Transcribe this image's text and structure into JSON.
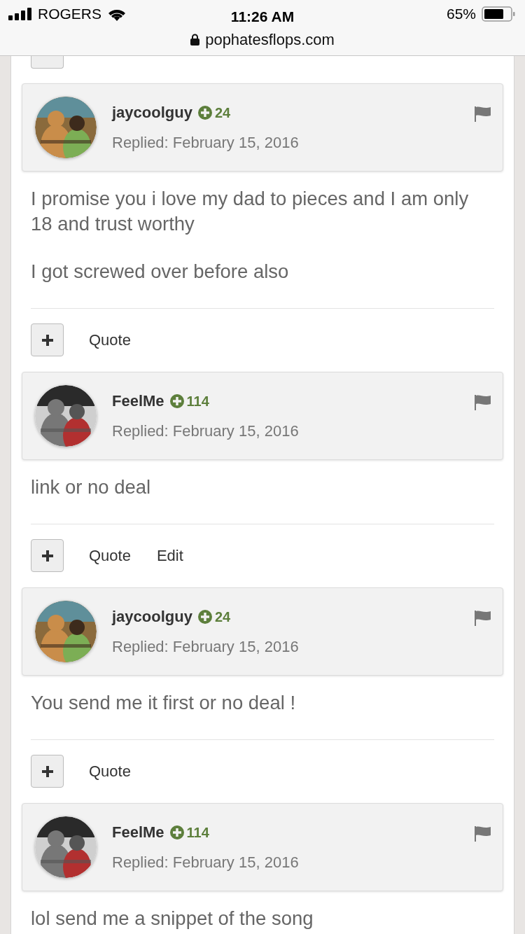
{
  "status_bar": {
    "carrier": "ROGERS",
    "time": "11:26 AM",
    "battery": "65%",
    "url": "pophatesflops.com"
  },
  "posts": [
    {
      "user": "jaycoolguy",
      "reputation": "24",
      "date": "Replied: February 15, 2016",
      "paragraphs": [
        "I promise you i love my dad to pieces and I am only 18 and trust worthy",
        "I got screwed over before also"
      ],
      "actions": [
        "Quote"
      ]
    },
    {
      "user": "FeelMe",
      "reputation": "114",
      "date": "Replied: February 15, 2016",
      "paragraphs": [
        "link or no deal"
      ],
      "actions": [
        "Quote",
        "Edit"
      ]
    },
    {
      "user": "jaycoolguy",
      "reputation": "24",
      "date": "Replied: February 15, 2016",
      "paragraphs": [
        "You send me it first or no deal !"
      ],
      "actions": [
        "Quote"
      ]
    },
    {
      "user": "FeelMe",
      "reputation": "114",
      "date": "Replied: February 15, 2016",
      "paragraphs": [
        "lol send me a snippet of the song"
      ]
    }
  ]
}
